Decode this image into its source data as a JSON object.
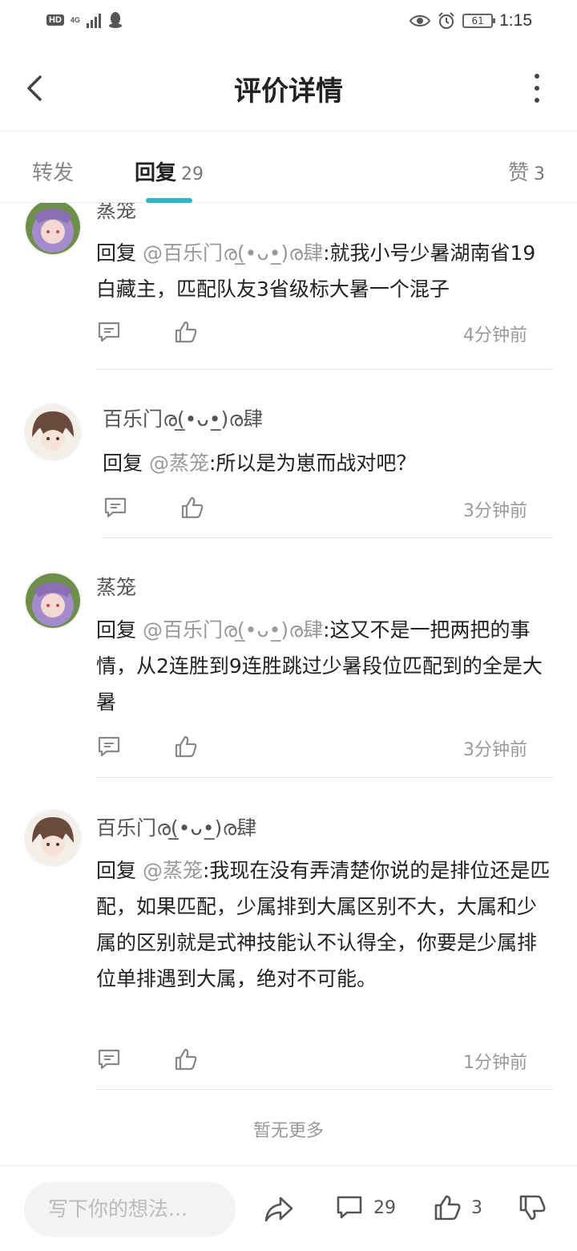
{
  "status_bar": {
    "hd": "HD",
    "network": "4G",
    "battery": "61",
    "time": "1:15"
  },
  "header": {
    "title": "评价详情"
  },
  "tabs": {
    "forward": {
      "label": "转发"
    },
    "reply": {
      "label": "回复",
      "count": "29"
    },
    "like": {
      "label": "赞",
      "count": "3"
    }
  },
  "comments": [
    {
      "username": "蒸笼",
      "reply_prefix": "回复",
      "mention": "@百乐门ര(̲•ᴗ•̲)ര肆",
      "text": ":就我小号少暑湖南省19白藏主，匹配队友3省级标大暑一个混子",
      "time": "4分钟前"
    },
    {
      "username": "百乐门ര(̲•ᴗ•̲)ര肆",
      "reply_prefix": "回复",
      "mention": "@蒸笼",
      "text": ":所以是为崽而战对吧？",
      "time": "3分钟前"
    },
    {
      "username": "蒸笼",
      "reply_prefix": "回复",
      "mention": "@百乐门ര(̲•ᴗ•̲)ര肆",
      "text": ":这又不是一把两把的事情，从2连胜到9连胜跳过少暑段位匹配到的全是大暑",
      "time": "3分钟前"
    },
    {
      "username": "百乐门ര(̲•ᴗ•̲)ര肆",
      "reply_prefix": "回复",
      "mention": "@蒸笼",
      "text": ":我现在没有弄清楚你说的是排位还是匹配，如果匹配，少属排到大属区别不大，大属和少属的区别就是式神技能认不认得全，你要是少属排位单排遇到大属，绝对不可能。",
      "time": "1分钟前"
    }
  ],
  "footer_note": "暂无更多",
  "bottom_bar": {
    "input_placeholder": "写下你的想法...",
    "comment_count": "29",
    "like_count": "3"
  },
  "colors": {
    "accent": "#2cb5c5",
    "muted_text": "#999999",
    "avatar_purple": "#8a6fb3",
    "avatar_brown": "#6b4a3e"
  }
}
